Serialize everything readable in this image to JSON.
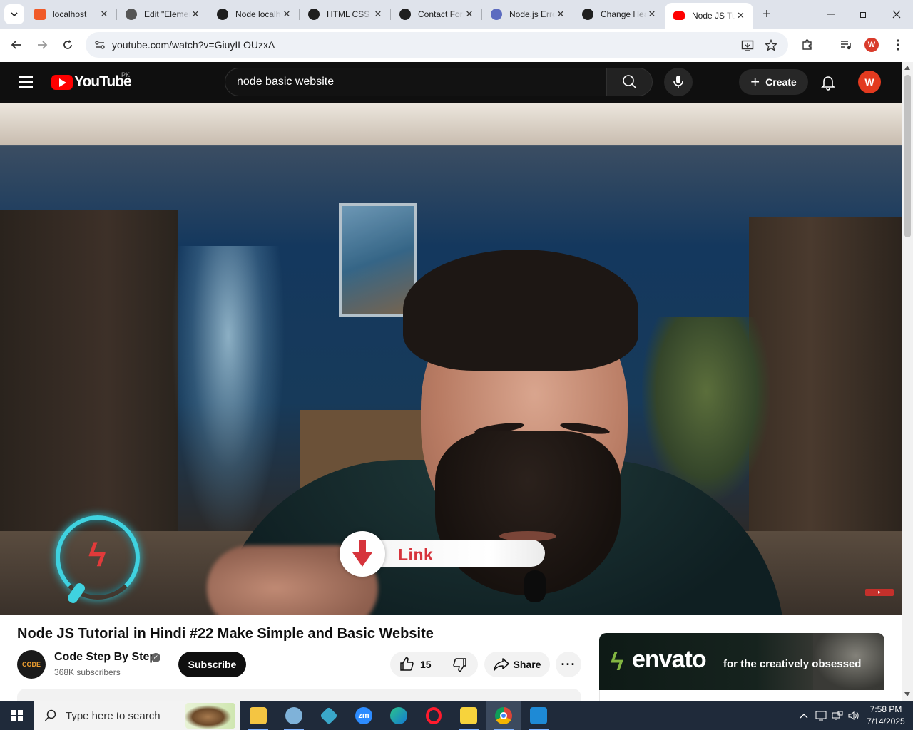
{
  "browser": {
    "tabs": [
      {
        "label": "localhost",
        "favicon_color": "#f05a28"
      },
      {
        "label": "Edit \"Elementor\"",
        "favicon_color": "#555555"
      },
      {
        "label": "Node localhost",
        "favicon_color": "#1f1f1f"
      },
      {
        "label": "HTML CSS",
        "favicon_color": "#1f1f1f"
      },
      {
        "label": "Contact Form",
        "favicon_color": "#1f1f1f"
      },
      {
        "label": "Node.js Error",
        "favicon_color": "#5c6bc0"
      },
      {
        "label": "Change Heading",
        "favicon_color": "#1f1f1f"
      },
      {
        "label": "Node JS Tutorial",
        "favicon_color": "#ff0000"
      }
    ],
    "active_tab_index": 7,
    "url": "youtube.com/watch?v=GiuyILOUzxA",
    "profile_initial": "W"
  },
  "youtube": {
    "logo_text": "YouTube",
    "country_code": "PK",
    "search_query": "node basic website",
    "create_label": "Create",
    "avatar_initial": "W"
  },
  "video": {
    "overlay_link_text": "Link",
    "title": "Node JS Tutorial in Hindi #22 Make Simple and Basic Website",
    "channel_name": "Code Step By Step",
    "channel_avatar_text": "CODE",
    "subscribers": "368K subscribers",
    "subscribe_label": "Subscribe",
    "like_count": "15",
    "share_label": "Share",
    "more_label": "···"
  },
  "ad": {
    "brand": "envato",
    "tagline": "for the creatively obsessed",
    "accent_color": "#82b541"
  },
  "taskbar": {
    "search_placeholder": "Type here to search",
    "time": "7:58 PM",
    "date": "7/14/2025"
  },
  "colors": {
    "youtube_red": "#ff0000",
    "header_bg": "#0f0f0f",
    "tabstrip_bg": "#dfe3eb",
    "taskbar_bg": "#1f2a3a"
  }
}
